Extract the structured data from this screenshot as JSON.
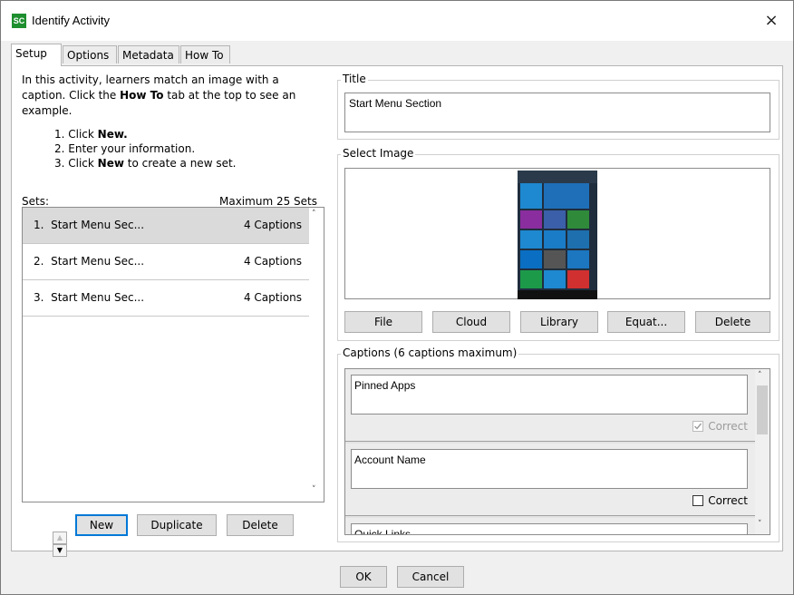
{
  "window": {
    "title": "Identify Activity",
    "app_icon_text": "SC",
    "close_glyph": "×"
  },
  "tabs": [
    {
      "label": "Setup",
      "active": true
    },
    {
      "label": "Options"
    },
    {
      "label": "Metadata"
    },
    {
      "label": "How To"
    }
  ],
  "instructions": {
    "line1": "In this activity, learners match an image with a",
    "line2_pre": "caption. Click the ",
    "line2_bold": "How To",
    "line2_post": " tab at the top to see an",
    "line3": "example.",
    "step1_pre": "1. Click ",
    "step1_bold": "New.",
    "step2": "2. Enter your information.",
    "step3_pre": "3. Click ",
    "step3_bold": "New",
    "step3_post": " to create a new set."
  },
  "sets": {
    "label": "Sets:",
    "max_label": "Maximum 25 Sets",
    "items": [
      {
        "index": "1.",
        "name": "Start Menu Sec...",
        "captions": "4 Captions"
      },
      {
        "index": "2.",
        "name": "Start Menu Sec...",
        "captions": "4 Captions"
      },
      {
        "index": "3.",
        "name": "Start Menu Sec...",
        "captions": "4 Captions"
      }
    ],
    "buttons": {
      "new": "New",
      "duplicate": "Duplicate",
      "delete": "Delete"
    }
  },
  "title_group": {
    "label": "Title",
    "value": "Start Menu Section"
  },
  "image_group": {
    "label": "Select Image",
    "buttons": {
      "file": "File",
      "cloud": "Cloud",
      "library": "Library",
      "equation": "Equat...",
      "delete": "Delete"
    }
  },
  "captions_group": {
    "label": "Captions (6 captions maximum)",
    "correct_label": "Correct",
    "items": [
      {
        "text": "Pinned Apps",
        "checked": true,
        "disabled": true
      },
      {
        "text": "Account Name",
        "checked": false,
        "disabled": false
      },
      {
        "text": "Quick Links",
        "checked": false,
        "disabled": false
      }
    ]
  },
  "footer": {
    "ok": "OK",
    "cancel": "Cancel"
  },
  "colors": {
    "accent": "#0078d7",
    "app_icon": "#1e8f2e"
  }
}
